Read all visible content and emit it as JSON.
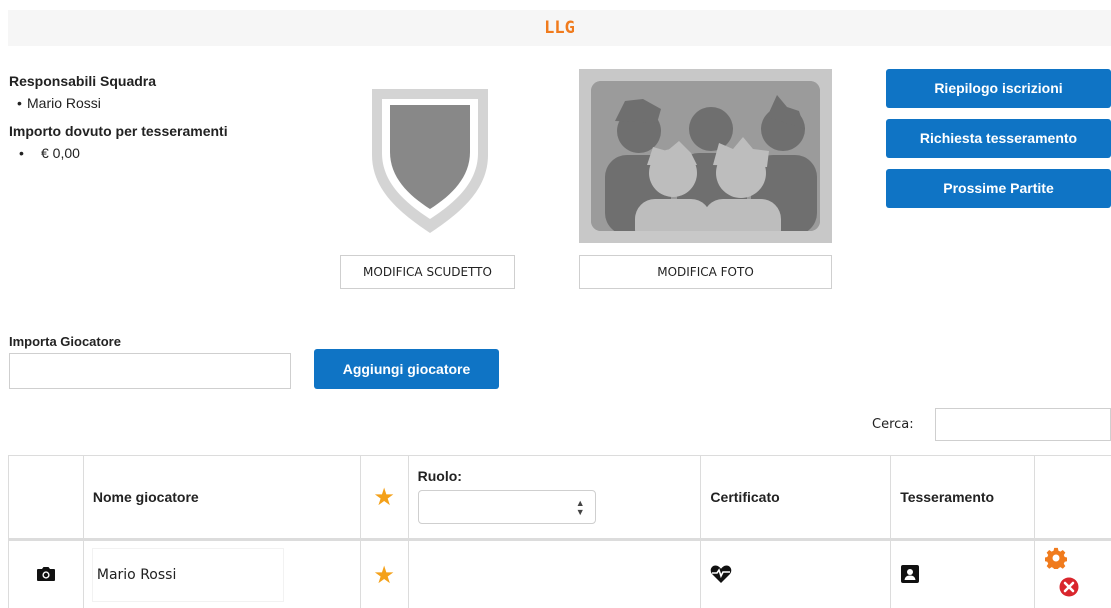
{
  "header": {
    "title": "LLG"
  },
  "team_info": {
    "responsabili_label": "Responsabili Squadra",
    "responsabili": [
      "Mario Rossi"
    ],
    "importo_label": "Importo dovuto per tesseramenti",
    "importo_value": "€ 0,00"
  },
  "buttons": {
    "modifica_scudetto": "MODIFICA SCUDETTO",
    "modifica_foto": "MODIFICA FOTO",
    "riepilogo": "Riepilogo iscrizioni",
    "richiesta": "Richiesta tesseramento",
    "prossime": "Prossime Partite",
    "aggiungi": "Aggiungi giocatore"
  },
  "import": {
    "label": "Importa Giocatore",
    "value": ""
  },
  "search": {
    "label": "Cerca:",
    "value": ""
  },
  "table": {
    "headers": {
      "nome": "Nome giocatore",
      "ruolo": "Ruolo:",
      "certificato": "Certificato",
      "tesseramento": "Tesseramento"
    },
    "ruolo_selected": "",
    "rows": [
      {
        "nome": "Mario Rossi"
      }
    ]
  },
  "icons": {
    "photo": "camera-icon",
    "star": "star-icon",
    "certificato": "heart-pulse-icon",
    "tesseramento": "id-card-icon",
    "settings": "gear-icon",
    "delete": "remove-circle-icon"
  },
  "colors": {
    "accent": "#f07b1d",
    "primary": "#0f74c5",
    "star": "#f4a11a",
    "delete": "#d9262d"
  }
}
